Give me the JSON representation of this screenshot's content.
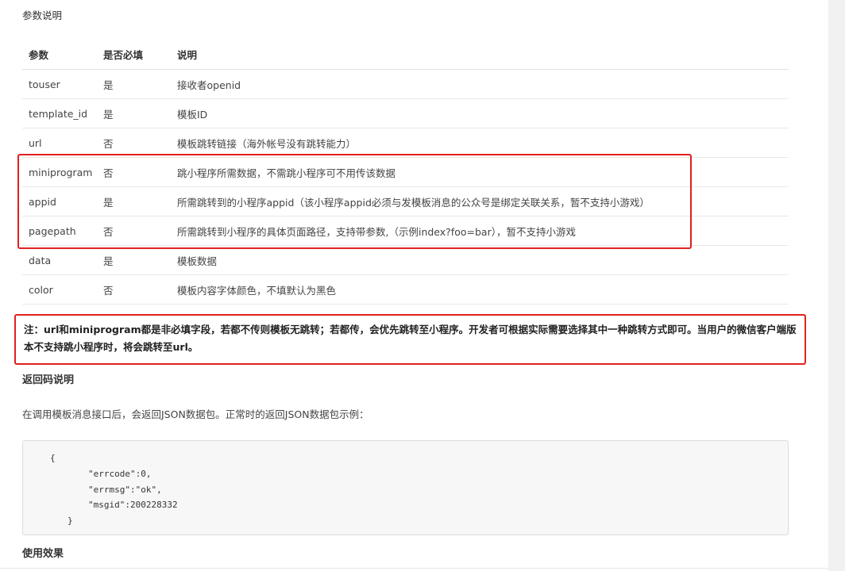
{
  "section_title": "参数说明",
  "table": {
    "headers": [
      "参数",
      "是否必填",
      "说明"
    ],
    "rows": [
      {
        "param": "touser",
        "required": "是",
        "desc": "接收者openid"
      },
      {
        "param": "template_id",
        "required": "是",
        "desc": "模板ID"
      },
      {
        "param": "url",
        "required": "否",
        "desc": "模板跳转链接（海外帐号没有跳转能力）"
      },
      {
        "param": "miniprogram",
        "required": "否",
        "desc": "跳小程序所需数据，不需跳小程序可不用传该数据"
      },
      {
        "param": "appid",
        "required": "是",
        "desc": "所需跳转到的小程序appid（该小程序appid必须与发模板消息的公众号是绑定关联关系，暂不支持小游戏）"
      },
      {
        "param": "pagepath",
        "required": "否",
        "desc": "所需跳转到小程序的具体页面路径，支持带参数,（示例index?foo=bar），暂不支持小游戏"
      },
      {
        "param": "data",
        "required": "是",
        "desc": "模板数据"
      },
      {
        "param": "color",
        "required": "否",
        "desc": "模板内容字体颜色，不填默认为黑色"
      }
    ]
  },
  "note": "注：url和miniprogram都是非必填字段，若都不传则模板无跳转；若都传，会优先跳转至小程序。开发者可根据实际需要选择其中一种跳转方式即可。当用户的微信客户端版本不支持跳小程序时，将会跳转至url。",
  "return_code": {
    "title": "返回码说明",
    "description": "在调用模板消息接口后，会返回JSON数据包。正常时的返回JSON数据包示例：",
    "code_lines": [
      "{",
      "\"errcode\":0,",
      "\"errmsg\":\"ok\",",
      "\"msgid\":200228332",
      "}"
    ]
  },
  "usage_title": "使用效果",
  "colors": {
    "highlight_border": "#e02020",
    "code_background": "#f7f7f7"
  }
}
